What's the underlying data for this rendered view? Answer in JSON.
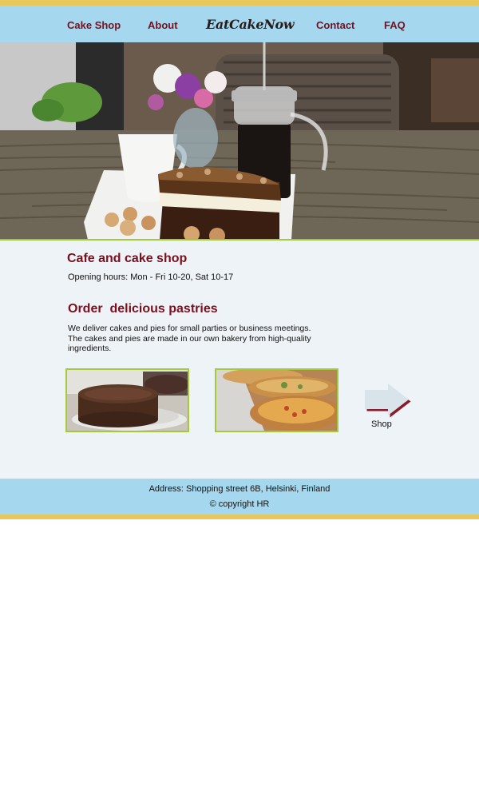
{
  "nav": {
    "items": [
      {
        "label": "Cake Shop"
      },
      {
        "label": "About"
      },
      {
        "label": "Contact"
      },
      {
        "label": "FAQ"
      }
    ],
    "logo": "EatCakeNow"
  },
  "hero": {
    "image": "cafe-table-cake-coffee-photo"
  },
  "main": {
    "title": "Cafe and cake shop",
    "hours": "Opening hours: Mon - Fri 10-20, Sat 10-17",
    "order_title": "Order  delicious pastries",
    "description": "We deliver cakes and pies for small parties or business meetings. The cakes and pies are made in our own bakery from high-quality ingredients.",
    "gallery": [
      {
        "image": "chocolate-cake-photo"
      },
      {
        "image": "quiche-pies-photo"
      }
    ],
    "shop_label": "Shop"
  },
  "footer": {
    "address": "Address: Shopping street 6B, Helsinki, Finland",
    "copyright": "© copyright HR"
  },
  "colors": {
    "nav_bg": "#a5d8ee",
    "accent_stripe": "#e8c85a",
    "link": "#7a0f1e",
    "content_bg": "#eef3f8",
    "thumb_border": "#a5c93a"
  }
}
